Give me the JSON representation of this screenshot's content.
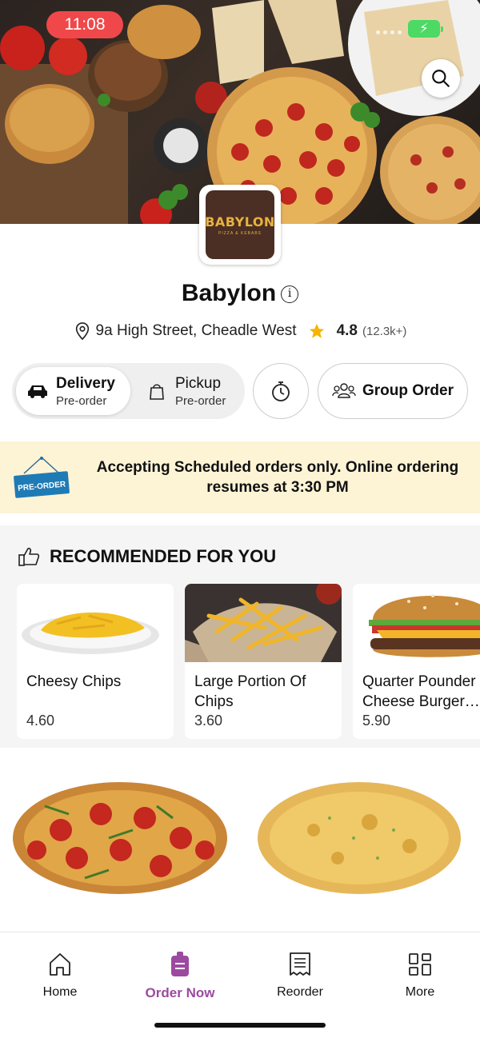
{
  "status_bar": {
    "time": "11:08"
  },
  "logo": {
    "title": "BABYLON",
    "subtitle": "PIZZA & KEBABS"
  },
  "restaurant": {
    "name": "Babylon",
    "address": "9a High Street, Cheadle West",
    "rating": "4.8",
    "rating_count": "(12.3k+)"
  },
  "order_modes": {
    "delivery": {
      "label": "Delivery",
      "sub": "Pre-order"
    },
    "pickup": {
      "label": "Pickup",
      "sub": "Pre-order"
    },
    "group_order": "Group Order"
  },
  "banner": {
    "sign_text": "PRE-ORDER",
    "message": "Accepting Scheduled orders only. Online ordering resumes at 3:30 PM"
  },
  "recommended": {
    "title": "RECOMMENDED FOR YOU",
    "items": [
      {
        "name": "Cheesy Chips",
        "price": "4.60"
      },
      {
        "name": "Large Portion Of Chips",
        "price": "3.60"
      },
      {
        "name": "Quarter Pounder Cheese Burger…",
        "price": "5.90"
      }
    ]
  },
  "nav": {
    "items": [
      {
        "label": "Home",
        "icon": "home-icon"
      },
      {
        "label": "Order Now",
        "icon": "order-bag-icon"
      },
      {
        "label": "Reorder",
        "icon": "receipt-icon"
      },
      {
        "label": "More",
        "icon": "grid-icon"
      }
    ],
    "active_color": "#9c4aa0"
  },
  "colors": {
    "accent": "#9c4aa0",
    "banner_bg": "#fdf4d6",
    "time_pill": "#f0484a",
    "star": "#f5b400"
  }
}
